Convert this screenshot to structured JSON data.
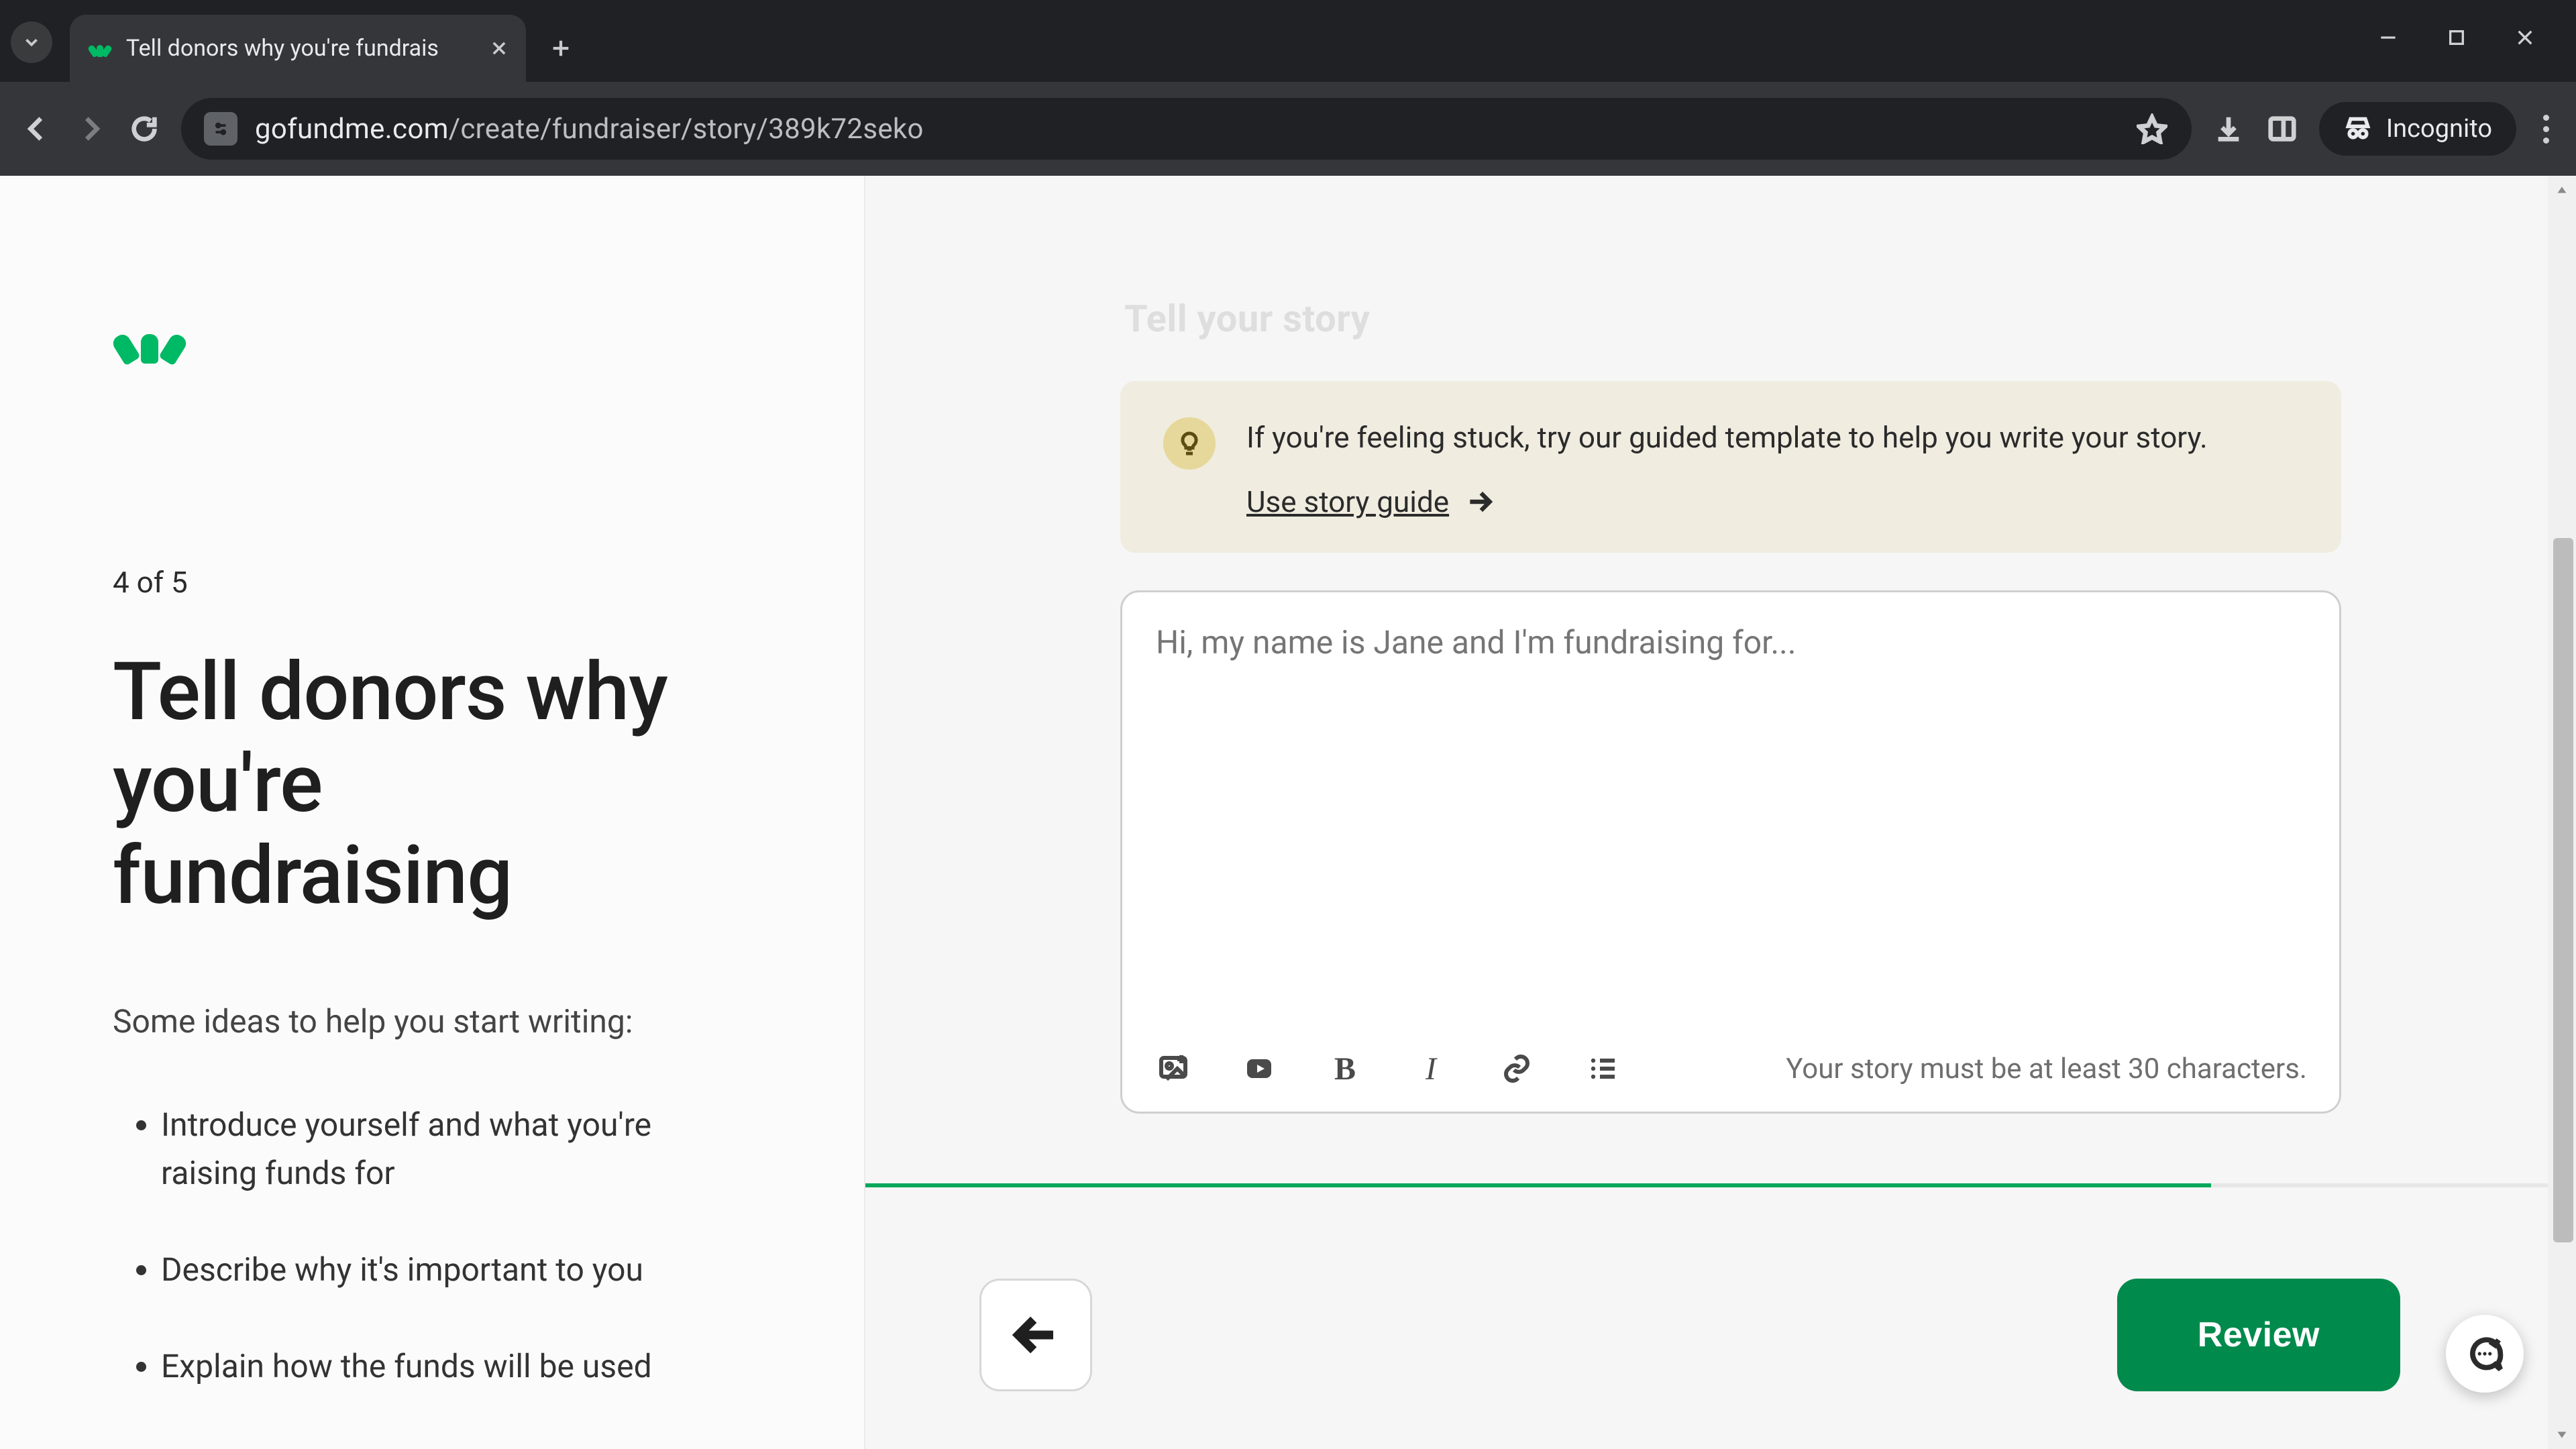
{
  "browser": {
    "tab_title": "Tell donors why you're fundrais",
    "url_domain": "gofundme.com",
    "url_path": "/create/fundraiser/story/389k72seko",
    "incognito_label": "Incognito"
  },
  "left_pane": {
    "step": "4 of 5",
    "headline": "Tell donors why you're fundraising",
    "subhead": "Some ideas to help you start writing:",
    "ideas": [
      "Introduce yourself and what you're raising funds for",
      "Describe why it's important to you",
      "Explain how the funds will be used"
    ]
  },
  "right_pane": {
    "ghost_title": "Tell your story",
    "tip_text": "If you're feeling stuck, try our guided template to help you write your story.",
    "tip_link": "Use story guide",
    "story_placeholder": "Hi, my name is Jane and I'm fundraising for...",
    "min_chars_hint": "Your story must be at least 30 characters."
  },
  "footer": {
    "review": "Review"
  },
  "progress": {
    "percent": 80
  }
}
